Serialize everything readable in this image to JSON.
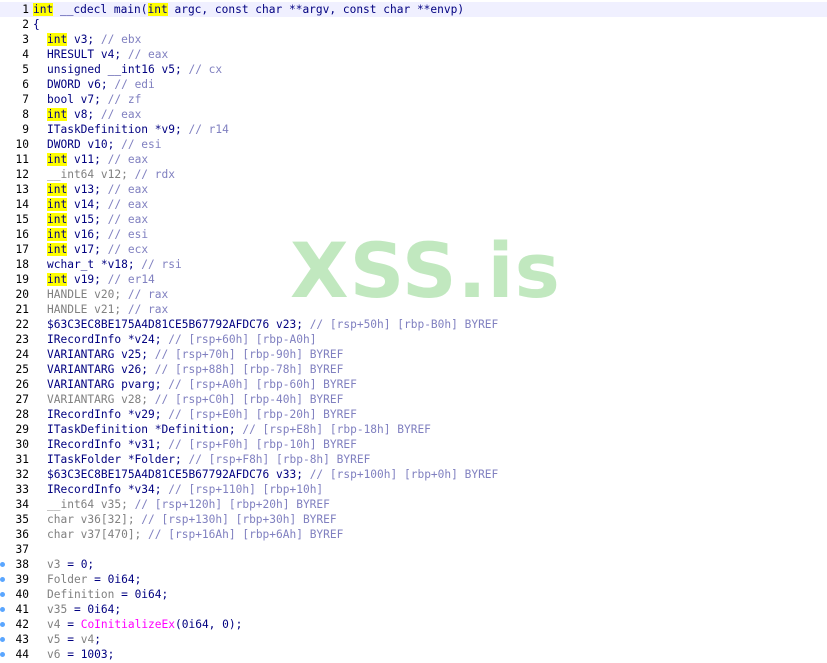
{
  "watermark": "XSS.is",
  "lines": [
    {
      "n": "1",
      "segs": [
        [
          "kw",
          "int"
        ],
        [
          "p",
          " __cdecl main("
        ],
        [
          "kw",
          "int"
        ],
        [
          "p",
          " argc, const char **argv, const char **envp)"
        ]
      ],
      "first": true
    },
    {
      "n": "2",
      "segs": [
        [
          "p",
          "{"
        ]
      ]
    },
    {
      "n": "3",
      "segs": [
        [
          "kw",
          "int"
        ],
        [
          "p",
          " v3; "
        ],
        [
          "cm",
          "// ebx"
        ]
      ],
      "ind": true
    },
    {
      "n": "4",
      "segs": [
        [
          "p",
          "HRESULT v4; "
        ],
        [
          "cm",
          "// eax"
        ]
      ],
      "ind": true
    },
    {
      "n": "5",
      "segs": [
        [
          "p",
          "unsigned __int16 v5; "
        ],
        [
          "cm",
          "// cx"
        ]
      ],
      "ind": true
    },
    {
      "n": "6",
      "segs": [
        [
          "p",
          "DWORD v6; "
        ],
        [
          "cm",
          "// edi"
        ]
      ],
      "ind": true
    },
    {
      "n": "7",
      "segs": [
        [
          "p",
          "bool v7; "
        ],
        [
          "cm",
          "// zf"
        ]
      ],
      "ind": true
    },
    {
      "n": "8",
      "segs": [
        [
          "kw",
          "int"
        ],
        [
          "p",
          " v8; "
        ],
        [
          "cm",
          "// eax"
        ]
      ],
      "ind": true
    },
    {
      "n": "9",
      "segs": [
        [
          "p",
          "ITaskDefinition *v9; "
        ],
        [
          "cm",
          "// r14"
        ]
      ],
      "ind": true
    },
    {
      "n": "10",
      "segs": [
        [
          "p",
          "DWORD v10; "
        ],
        [
          "cm",
          "// esi"
        ]
      ],
      "ind": true
    },
    {
      "n": "11",
      "segs": [
        [
          "kw",
          "int"
        ],
        [
          "p",
          " v11; "
        ],
        [
          "cm",
          "// eax"
        ]
      ],
      "ind": true
    },
    {
      "n": "12",
      "segs": [
        [
          "gray",
          "__int64 v12; "
        ],
        [
          "cm",
          "// rdx"
        ]
      ],
      "ind": true
    },
    {
      "n": "13",
      "segs": [
        [
          "kw",
          "int"
        ],
        [
          "p",
          " v13; "
        ],
        [
          "cm",
          "// eax"
        ]
      ],
      "ind": true
    },
    {
      "n": "14",
      "segs": [
        [
          "kw",
          "int"
        ],
        [
          "p",
          " v14; "
        ],
        [
          "cm",
          "// eax"
        ]
      ],
      "ind": true
    },
    {
      "n": "15",
      "segs": [
        [
          "kw",
          "int"
        ],
        [
          "p",
          " v15; "
        ],
        [
          "cm",
          "// eax"
        ]
      ],
      "ind": true
    },
    {
      "n": "16",
      "segs": [
        [
          "kw",
          "int"
        ],
        [
          "p",
          " v16; "
        ],
        [
          "cm",
          "// esi"
        ]
      ],
      "ind": true
    },
    {
      "n": "17",
      "segs": [
        [
          "kw",
          "int"
        ],
        [
          "p",
          " v17; "
        ],
        [
          "cm",
          "// ecx"
        ]
      ],
      "ind": true
    },
    {
      "n": "18",
      "segs": [
        [
          "p",
          "wchar_t *v18; "
        ],
        [
          "cm",
          "// rsi"
        ]
      ],
      "ind": true
    },
    {
      "n": "19",
      "segs": [
        [
          "kw",
          "int"
        ],
        [
          "p",
          " v19; "
        ],
        [
          "cm",
          "// er14"
        ]
      ],
      "ind": true
    },
    {
      "n": "20",
      "segs": [
        [
          "gray",
          "HANDLE v20; "
        ],
        [
          "cm",
          "// rax"
        ]
      ],
      "ind": true
    },
    {
      "n": "21",
      "segs": [
        [
          "gray",
          "HANDLE v21; "
        ],
        [
          "cm",
          "// rax"
        ]
      ],
      "ind": true
    },
    {
      "n": "22",
      "segs": [
        [
          "p",
          "$63C3EC8BE175A4D81CE5B67792AFDC76 v23; "
        ],
        [
          "cm",
          "// [rsp+50h] [rbp-B0h] BYREF"
        ]
      ],
      "ind": true
    },
    {
      "n": "23",
      "segs": [
        [
          "p",
          "IRecordInfo *v24; "
        ],
        [
          "cm",
          "// [rsp+60h] [rbp-A0h]"
        ]
      ],
      "ind": true
    },
    {
      "n": "24",
      "segs": [
        [
          "p",
          "VARIANTARG v25; "
        ],
        [
          "cm",
          "// [rsp+70h] [rbp-90h] BYREF"
        ]
      ],
      "ind": true
    },
    {
      "n": "25",
      "segs": [
        [
          "p",
          "VARIANTARG v26; "
        ],
        [
          "cm",
          "// [rsp+88h] [rbp-78h] BYREF"
        ]
      ],
      "ind": true
    },
    {
      "n": "26",
      "segs": [
        [
          "p",
          "VARIANTARG pvarg; "
        ],
        [
          "cm",
          "// [rsp+A0h] [rbp-60h] BYREF"
        ]
      ],
      "ind": true
    },
    {
      "n": "27",
      "segs": [
        [
          "gray",
          "VARIANTARG v28; "
        ],
        [
          "cm",
          "// [rsp+C0h] [rbp-40h] BYREF"
        ]
      ],
      "ind": true
    },
    {
      "n": "28",
      "segs": [
        [
          "p",
          "IRecordInfo *v29; "
        ],
        [
          "cm",
          "// [rsp+E0h] [rbp-20h] BYREF"
        ]
      ],
      "ind": true
    },
    {
      "n": "29",
      "segs": [
        [
          "p",
          "ITaskDefinition *Definition; "
        ],
        [
          "cm",
          "// [rsp+E8h] [rbp-18h] BYREF"
        ]
      ],
      "ind": true
    },
    {
      "n": "30",
      "segs": [
        [
          "p",
          "IRecordInfo *v31; "
        ],
        [
          "cm",
          "// [rsp+F0h] [rbp-10h] BYREF"
        ]
      ],
      "ind": true
    },
    {
      "n": "31",
      "segs": [
        [
          "p",
          "ITaskFolder *Folder; "
        ],
        [
          "cm",
          "// [rsp+F8h] [rbp-8h] BYREF"
        ]
      ],
      "ind": true
    },
    {
      "n": "32",
      "segs": [
        [
          "p",
          "$63C3EC8BE175A4D81CE5B67792AFDC76 v33; "
        ],
        [
          "cm",
          "// [rsp+100h] [rbp+0h] BYREF"
        ]
      ],
      "ind": true
    },
    {
      "n": "33",
      "segs": [
        [
          "p",
          "IRecordInfo *v34; "
        ],
        [
          "cm",
          "// [rsp+110h] [rbp+10h]"
        ]
      ],
      "ind": true
    },
    {
      "n": "34",
      "segs": [
        [
          "gray",
          "__int64 v35; "
        ],
        [
          "cm",
          "// [rsp+120h] [rbp+20h] BYREF"
        ]
      ],
      "ind": true
    },
    {
      "n": "35",
      "segs": [
        [
          "gray",
          "char v36[32]; "
        ],
        [
          "cm",
          "// [rsp+130h] [rbp+30h] BYREF"
        ]
      ],
      "ind": true
    },
    {
      "n": "36",
      "segs": [
        [
          "gray",
          "char v37[470]; "
        ],
        [
          "cm",
          "// [rsp+16Ah] [rbp+6Ah] BYREF"
        ]
      ],
      "ind": true
    },
    {
      "n": "37",
      "segs": []
    },
    {
      "n": "38",
      "segs": [
        [
          "gray",
          "v3"
        ],
        [
          "p",
          " = 0;"
        ]
      ],
      "ind": true,
      "dot": true
    },
    {
      "n": "39",
      "segs": [
        [
          "gray",
          "Folder"
        ],
        [
          "p",
          " = 0i64;"
        ]
      ],
      "ind": true,
      "dot": true
    },
    {
      "n": "40",
      "segs": [
        [
          "gray",
          "Definition"
        ],
        [
          "p",
          " = 0i64;"
        ]
      ],
      "ind": true,
      "dot": true
    },
    {
      "n": "41",
      "segs": [
        [
          "gray",
          "v35"
        ],
        [
          "p",
          " = 0i64;"
        ]
      ],
      "ind": true,
      "dot": true
    },
    {
      "n": "42",
      "segs": [
        [
          "gray",
          "v4"
        ],
        [
          "p",
          " = "
        ],
        [
          "fn",
          "CoInitializeEx"
        ],
        [
          "p",
          "(0i64, 0);"
        ]
      ],
      "ind": true,
      "dot": true
    },
    {
      "n": "43",
      "segs": [
        [
          "gray",
          "v5"
        ],
        [
          "p",
          " = "
        ],
        [
          "gray",
          "v4"
        ],
        [
          "p",
          ";"
        ]
      ],
      "ind": true,
      "dot": true
    },
    {
      "n": "44",
      "segs": [
        [
          "gray",
          "v6"
        ],
        [
          "p",
          " = 1003;"
        ]
      ],
      "ind": true,
      "dot": true
    }
  ]
}
